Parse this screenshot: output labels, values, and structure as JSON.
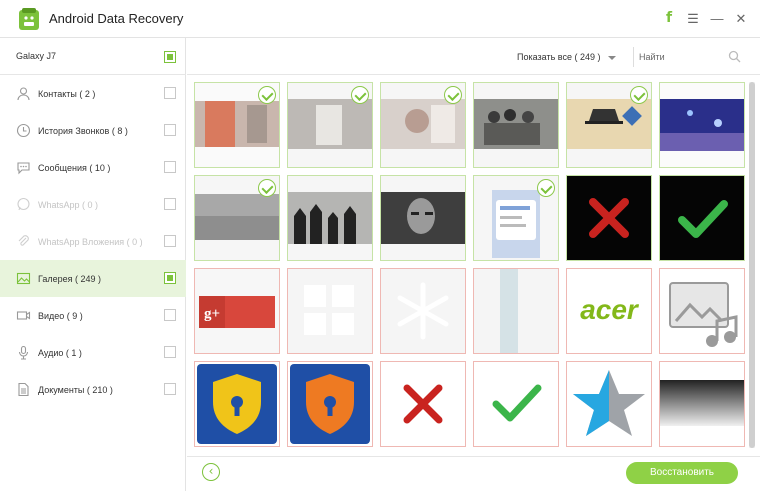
{
  "app": {
    "title": "Android Data Recovery"
  },
  "window_controls": {
    "facebook": "f",
    "menu": "☰",
    "minimize": "—",
    "close": "✕"
  },
  "device": {
    "name": "Galaxy J7",
    "checked": true
  },
  "categories": [
    {
      "label": "Контакты ( 2 )",
      "icon": "contacts-icon",
      "checked": false,
      "active": false,
      "disabled": false
    },
    {
      "label": "История Звонков ( 8 )",
      "icon": "clock-icon",
      "checked": false,
      "active": false,
      "disabled": false
    },
    {
      "label": "Сообщения ( 10 )",
      "icon": "message-icon",
      "checked": false,
      "active": false,
      "disabled": false
    },
    {
      "label": "WhatsApp ( 0 )",
      "icon": "whatsapp-icon",
      "checked": false,
      "active": false,
      "disabled": true
    },
    {
      "label": "WhatsApp Вложения ( 0 )",
      "icon": "paperclip-icon",
      "checked": false,
      "active": false,
      "disabled": true
    },
    {
      "label": "Галерея ( 249 )",
      "icon": "gallery-icon",
      "checked": true,
      "active": true,
      "disabled": false
    },
    {
      "label": "Видео ( 9 )",
      "icon": "video-icon",
      "checked": false,
      "active": false,
      "disabled": false
    },
    {
      "label": "Аудио ( 1 )",
      "icon": "microphone-icon",
      "checked": false,
      "active": false,
      "disabled": false
    },
    {
      "label": "Документы ( 210 )",
      "icon": "document-icon",
      "checked": false,
      "active": false,
      "disabled": false
    }
  ],
  "toolbar": {
    "filter_label": "Показать все ( 249 )",
    "search_placeholder": "Найти"
  },
  "gallery": [
    {
      "kind": "photo-wall",
      "selected": true,
      "deleted": false
    },
    {
      "kind": "photo-dim",
      "selected": true,
      "deleted": false
    },
    {
      "kind": "photo-figure",
      "selected": true,
      "deleted": false
    },
    {
      "kind": "photo-group",
      "selected": false,
      "deleted": false
    },
    {
      "kind": "photo-hat",
      "selected": true,
      "deleted": false
    },
    {
      "kind": "photo-aquarium",
      "selected": false,
      "deleted": false
    },
    {
      "kind": "photo-gray",
      "selected": true,
      "deleted": false
    },
    {
      "kind": "photo-silhouettes",
      "selected": false,
      "deleted": false
    },
    {
      "kind": "photo-face",
      "selected": false,
      "deleted": false
    },
    {
      "kind": "screenshot-app",
      "selected": true,
      "deleted": false
    },
    {
      "kind": "red-cross-dark",
      "selected": false,
      "deleted": false
    },
    {
      "kind": "green-check-dark",
      "selected": false,
      "deleted": false
    },
    {
      "kind": "google-plus-banner",
      "selected": false,
      "deleted": true,
      "text": "g+"
    },
    {
      "kind": "grid-icon",
      "selected": false,
      "deleted": true
    },
    {
      "kind": "snowflake-icon",
      "selected": false,
      "deleted": true
    },
    {
      "kind": "panel-strip",
      "selected": false,
      "deleted": true
    },
    {
      "kind": "acer-logo",
      "selected": false,
      "deleted": true,
      "text": "acer"
    },
    {
      "kind": "gallery-music-icon",
      "selected": false,
      "deleted": true
    },
    {
      "kind": "shield-yellow",
      "selected": false,
      "deleted": true
    },
    {
      "kind": "shield-orange",
      "selected": false,
      "deleted": true
    },
    {
      "kind": "red-cross-white",
      "selected": false,
      "deleted": true
    },
    {
      "kind": "green-check-white",
      "selected": false,
      "deleted": true
    },
    {
      "kind": "blue-star",
      "selected": false,
      "deleted": true
    },
    {
      "kind": "gray-gradient",
      "selected": false,
      "deleted": true
    }
  ],
  "footer": {
    "back": "‹",
    "recover_label": "Восстановить"
  },
  "colors": {
    "accent": "#7cc23b",
    "selected_border": "#c6e3a6",
    "deleted_border": "#efb8b3"
  }
}
